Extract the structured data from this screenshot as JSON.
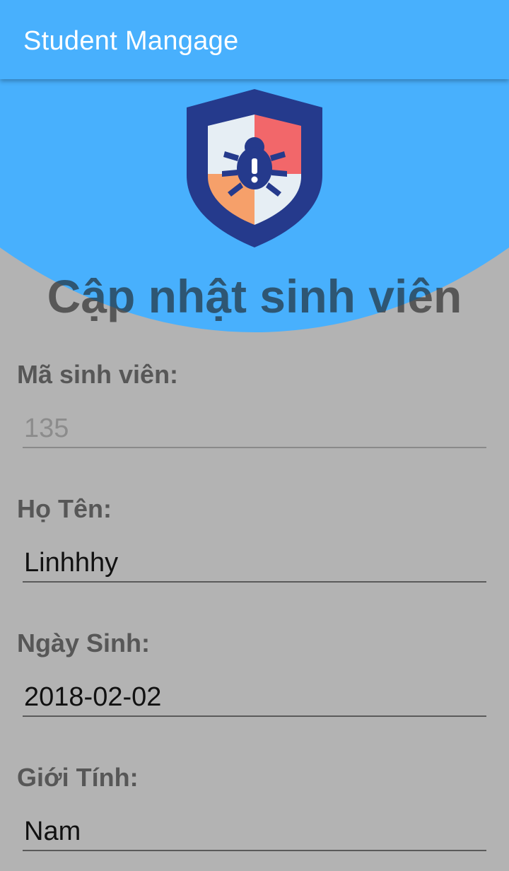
{
  "app": {
    "title": "Student Mangage"
  },
  "colors": {
    "primary": "#48b0fd",
    "background": "#b3b3b3",
    "shield_outer": "#253a8c",
    "shield_red": "#f2676a",
    "shield_orange": "#f6a06a",
    "shield_light": "#e6eef4"
  },
  "header": {
    "logo_icon": "shield-bug-icon",
    "title": "Cập nhật sinh viên"
  },
  "form": {
    "fields": [
      {
        "label": "Mã sinh viên:",
        "value": "135",
        "enabled": false
      },
      {
        "label": "Họ Tên:",
        "value": "Linhhhy",
        "enabled": true
      },
      {
        "label": "Ngày Sinh:",
        "value": "2018-02-02",
        "enabled": true
      },
      {
        "label": "Giới Tính:",
        "value": "Nam",
        "enabled": true
      }
    ]
  }
}
